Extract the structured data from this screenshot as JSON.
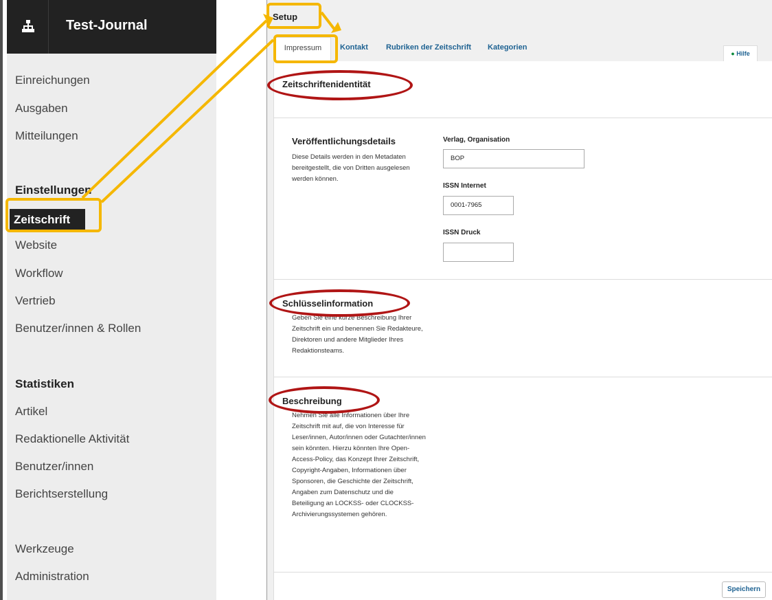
{
  "app": {
    "journal_title": "Test-Journal"
  },
  "sidebar": {
    "items": [
      {
        "label": "Einreichungen"
      },
      {
        "label": "Ausgaben"
      },
      {
        "label": "Mitteilungen"
      }
    ],
    "settings_heading": "Einstellungen",
    "settings_items": [
      {
        "label": "Zeitschrift"
      },
      {
        "label": "Website"
      },
      {
        "label": "Workflow"
      },
      {
        "label": "Vertrieb"
      },
      {
        "label": "Benutzer/innen & Rollen"
      }
    ],
    "stats_heading": "Statistiken",
    "stats_items": [
      {
        "label": "Artikel"
      },
      {
        "label": "Redaktionelle Aktivität"
      },
      {
        "label": "Benutzer/innen"
      },
      {
        "label": "Berichtserstellung"
      }
    ],
    "bottom_items": [
      {
        "label": "Werkzeuge"
      },
      {
        "label": "Administration"
      }
    ]
  },
  "main": {
    "title": "Setup",
    "tabs": [
      {
        "label": "Impressum"
      },
      {
        "label": "Kontakt"
      },
      {
        "label": "Rubriken der Zeitschrift"
      },
      {
        "label": "Kategorien"
      }
    ],
    "help_label": "Hilfe",
    "section_identity": "Zeitschriftenidentität",
    "publication": {
      "title": "Veröffentlichungsdetails",
      "description": "Diese Details werden in den Metadaten bereitgestellt, die von Dritten ausgelesen werden können.",
      "publisher_label": "Verlag, Organisation",
      "publisher_value": "BOP",
      "issn_online_label": "ISSN Internet",
      "issn_online_value": "0001-7965",
      "issn_print_label": "ISSN Druck",
      "issn_print_value": ""
    },
    "key_info": {
      "title": "Schlüsselinformation",
      "description": "Geben Sie eine kurze Beschreibung Ihrer Zeitschrift ein und benennen Sie Redakteure, Direktoren und andere Mitglieder Ihres Redaktionsteams."
    },
    "description": {
      "title": "Beschreibung",
      "description": "Nehmen Sie alle Informationen über Ihre Zeitschrift mit auf, die von Interesse für Leser/innen, Autor/innen oder Gutachter/innen sein könnten. Hierzu könnten Ihre Open-Access-Policy, das Konzept Ihrer Zeitschrift, Copyright-Angaben, Informationen über Sponsoren, die Geschichte der Zeitschrift, Angaben zum Datenschutz und die Beteiligung an LOCKSS- oder CLOCKSS-Archivierungssystemen gehören."
    },
    "save_label": "Speichern"
  },
  "colors": {
    "highlight_box": "#f5b700",
    "highlight_ellipse": "#b01515",
    "link": "#1e6292",
    "topbar": "#222222"
  }
}
